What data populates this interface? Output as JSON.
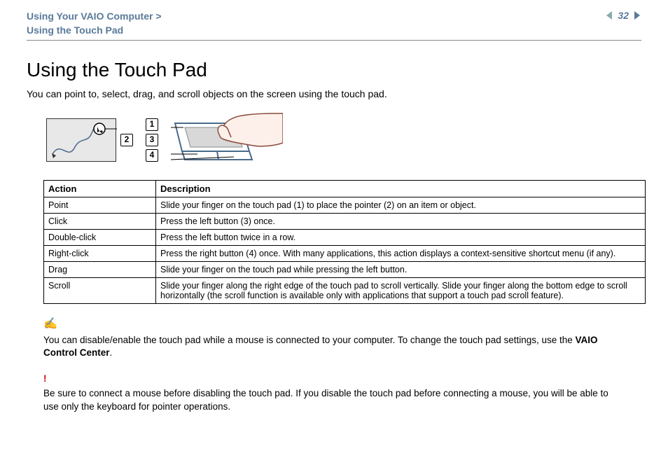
{
  "header": {
    "breadcrumb_line1": "Using Your VAIO Computer >",
    "breadcrumb_line2": "Using the Touch Pad",
    "page_number": "32"
  },
  "title": "Using the Touch Pad",
  "intro": "You can point to, select, drag, and scroll objects on the screen using the touch pad.",
  "callouts": {
    "pointer": "2",
    "touchpad": "1",
    "left_button": "3",
    "right_button": "4"
  },
  "table": {
    "headers": {
      "action": "Action",
      "description": "Description"
    },
    "rows": [
      {
        "action": "Point",
        "description": "Slide your finger on the touch pad (1) to place the pointer (2) on an item or object."
      },
      {
        "action": "Click",
        "description": "Press the left button (3) once."
      },
      {
        "action": "Double-click",
        "description": "Press the left button twice in a row."
      },
      {
        "action": "Right-click",
        "description": "Press the right button (4) once. With many applications, this action displays a context-sensitive shortcut menu (if any)."
      },
      {
        "action": "Drag",
        "description": "Slide your finger on the touch pad while pressing the left button."
      },
      {
        "action": "Scroll",
        "description": "Slide your finger along the right edge of the touch pad to scroll vertically. Slide your finger along the bottom edge to scroll horizontally (the scroll function is available only with applications that support a touch pad scroll feature)."
      }
    ]
  },
  "note": {
    "text_before": "You can disable/enable the touch pad while a mouse is connected to your computer. To change the touch pad settings, use the ",
    "bold": "VAIO Control Center",
    "text_after": "."
  },
  "warning": {
    "text": "Be sure to connect a mouse before disabling the touch pad. If you disable the touch pad before connecting a mouse, you will be able to use only the keyboard for pointer operations."
  }
}
